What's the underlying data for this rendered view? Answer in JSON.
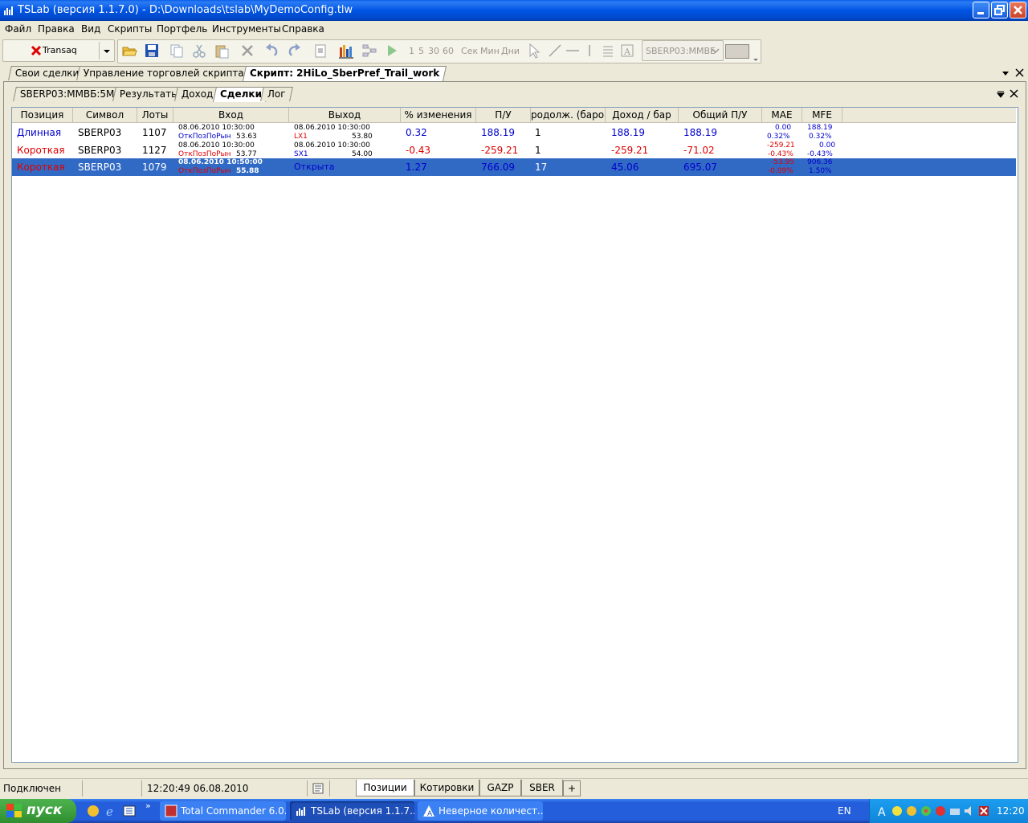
{
  "window": {
    "title": "TSLab (версия 1.1.7.0) - D:\\Downloads\\tslab\\MyDemoConfig.tlw"
  },
  "menu": [
    "Файл",
    "Правка",
    "Вид",
    "Скрипты",
    "Портфель",
    "Инструменты",
    "Справка"
  ],
  "toolbar": {
    "connector": "Transaq",
    "intervals": [
      "1",
      "5",
      "30",
      "60"
    ],
    "units": [
      "Сек",
      "Мин",
      "Дни"
    ],
    "symbol_select": "SBERP03:ММВБ"
  },
  "doc_tabs": [
    {
      "label": "Свои сделки",
      "active": false
    },
    {
      "label": "Управление торговлей скриптами",
      "active": false
    },
    {
      "label": "Скрипт: 2HiLo_SberPref_Trail_work",
      "active": true
    }
  ],
  "sub_tabs": [
    {
      "label": "SBERP03:ММВБ:5M",
      "active": false
    },
    {
      "label": "Результаты",
      "active": false
    },
    {
      "label": "Доход",
      "active": false
    },
    {
      "label": "Сделки",
      "active": true
    },
    {
      "label": "Лог",
      "active": false
    }
  ],
  "grid": {
    "columns": [
      "Позиция",
      "Символ",
      "Лоты",
      "Вход",
      "Выход",
      "% изменения",
      "П/У",
      "родолж. (баров",
      "Доход / бар",
      "Общий П/У",
      "MAE",
      "MFE"
    ],
    "rows": [
      {
        "position": "Длинная",
        "symbol": "SBERP03",
        "lots": "1107",
        "entry_date": "08.06.2010 10:30:00",
        "entry_name": "ОткПозПоРын",
        "entry_price": "53.63",
        "exit_date": "08.06.2010 10:30:00",
        "exit_name": "LX1",
        "exit_price": "53.80",
        "pct": "0.32",
        "pl": "188.19",
        "bars": "1",
        "pl_bar": "188.19",
        "total_pl": "188.19",
        "mae_val": "0.00",
        "mae_pct": "0.32%",
        "mfe_val": "188.19",
        "mfe_pct": "0.32%"
      },
      {
        "position": "Короткая",
        "symbol": "SBERP03",
        "lots": "1127",
        "entry_date": "08.06.2010 10:30:00",
        "entry_name": "ОткПозПоРын",
        "entry_price": "53.77",
        "exit_date": "08.06.2010 10:30:00",
        "exit_name": "SX1",
        "exit_price": "54.00",
        "pct": "-0.43",
        "pl": "-259.21",
        "bars": "1",
        "pl_bar": "-259.21",
        "total_pl": "-71.02",
        "mae_val": "-259.21",
        "mae_pct": "-0.43%",
        "mfe_val": "0.00",
        "mfe_pct": "-0.43%"
      },
      {
        "position": "Короткая",
        "symbol": "SBERP03",
        "lots": "1079",
        "entry_date": "08.06.2010 10:50:00",
        "entry_name": "ОткПозПоРын",
        "entry_price": "55.88",
        "exit_date": "",
        "exit_name": "Открыта",
        "exit_price": "",
        "pct": "1.27",
        "pl": "766.09",
        "bars": "17",
        "pl_bar": "45.06",
        "total_pl": "695.07",
        "mae_val": "-53.95",
        "mae_pct": "-0.09%",
        "mfe_val": "906.36",
        "mfe_pct": "1.50%"
      }
    ]
  },
  "status": {
    "connection": "Подключен",
    "time": "12:20:49 06.08.2010"
  },
  "bottom_tabs": [
    {
      "label": "Позиции",
      "active": true
    },
    {
      "label": "Котировки",
      "active": false
    },
    {
      "label": "GAZP",
      "active": false
    },
    {
      "label": "SBER",
      "active": false
    },
    {
      "label": "+",
      "active": false
    }
  ],
  "taskbar": {
    "start": "пуск",
    "tasks": [
      "Total Commander 6.0...",
      "TSLab (версия 1.1.7....",
      "Неверное количест..."
    ],
    "lang": "EN",
    "clock": "12:20"
  },
  "colors": {
    "long": "#0000cc",
    "short": "#e00000",
    "selection": "#316ac5"
  }
}
